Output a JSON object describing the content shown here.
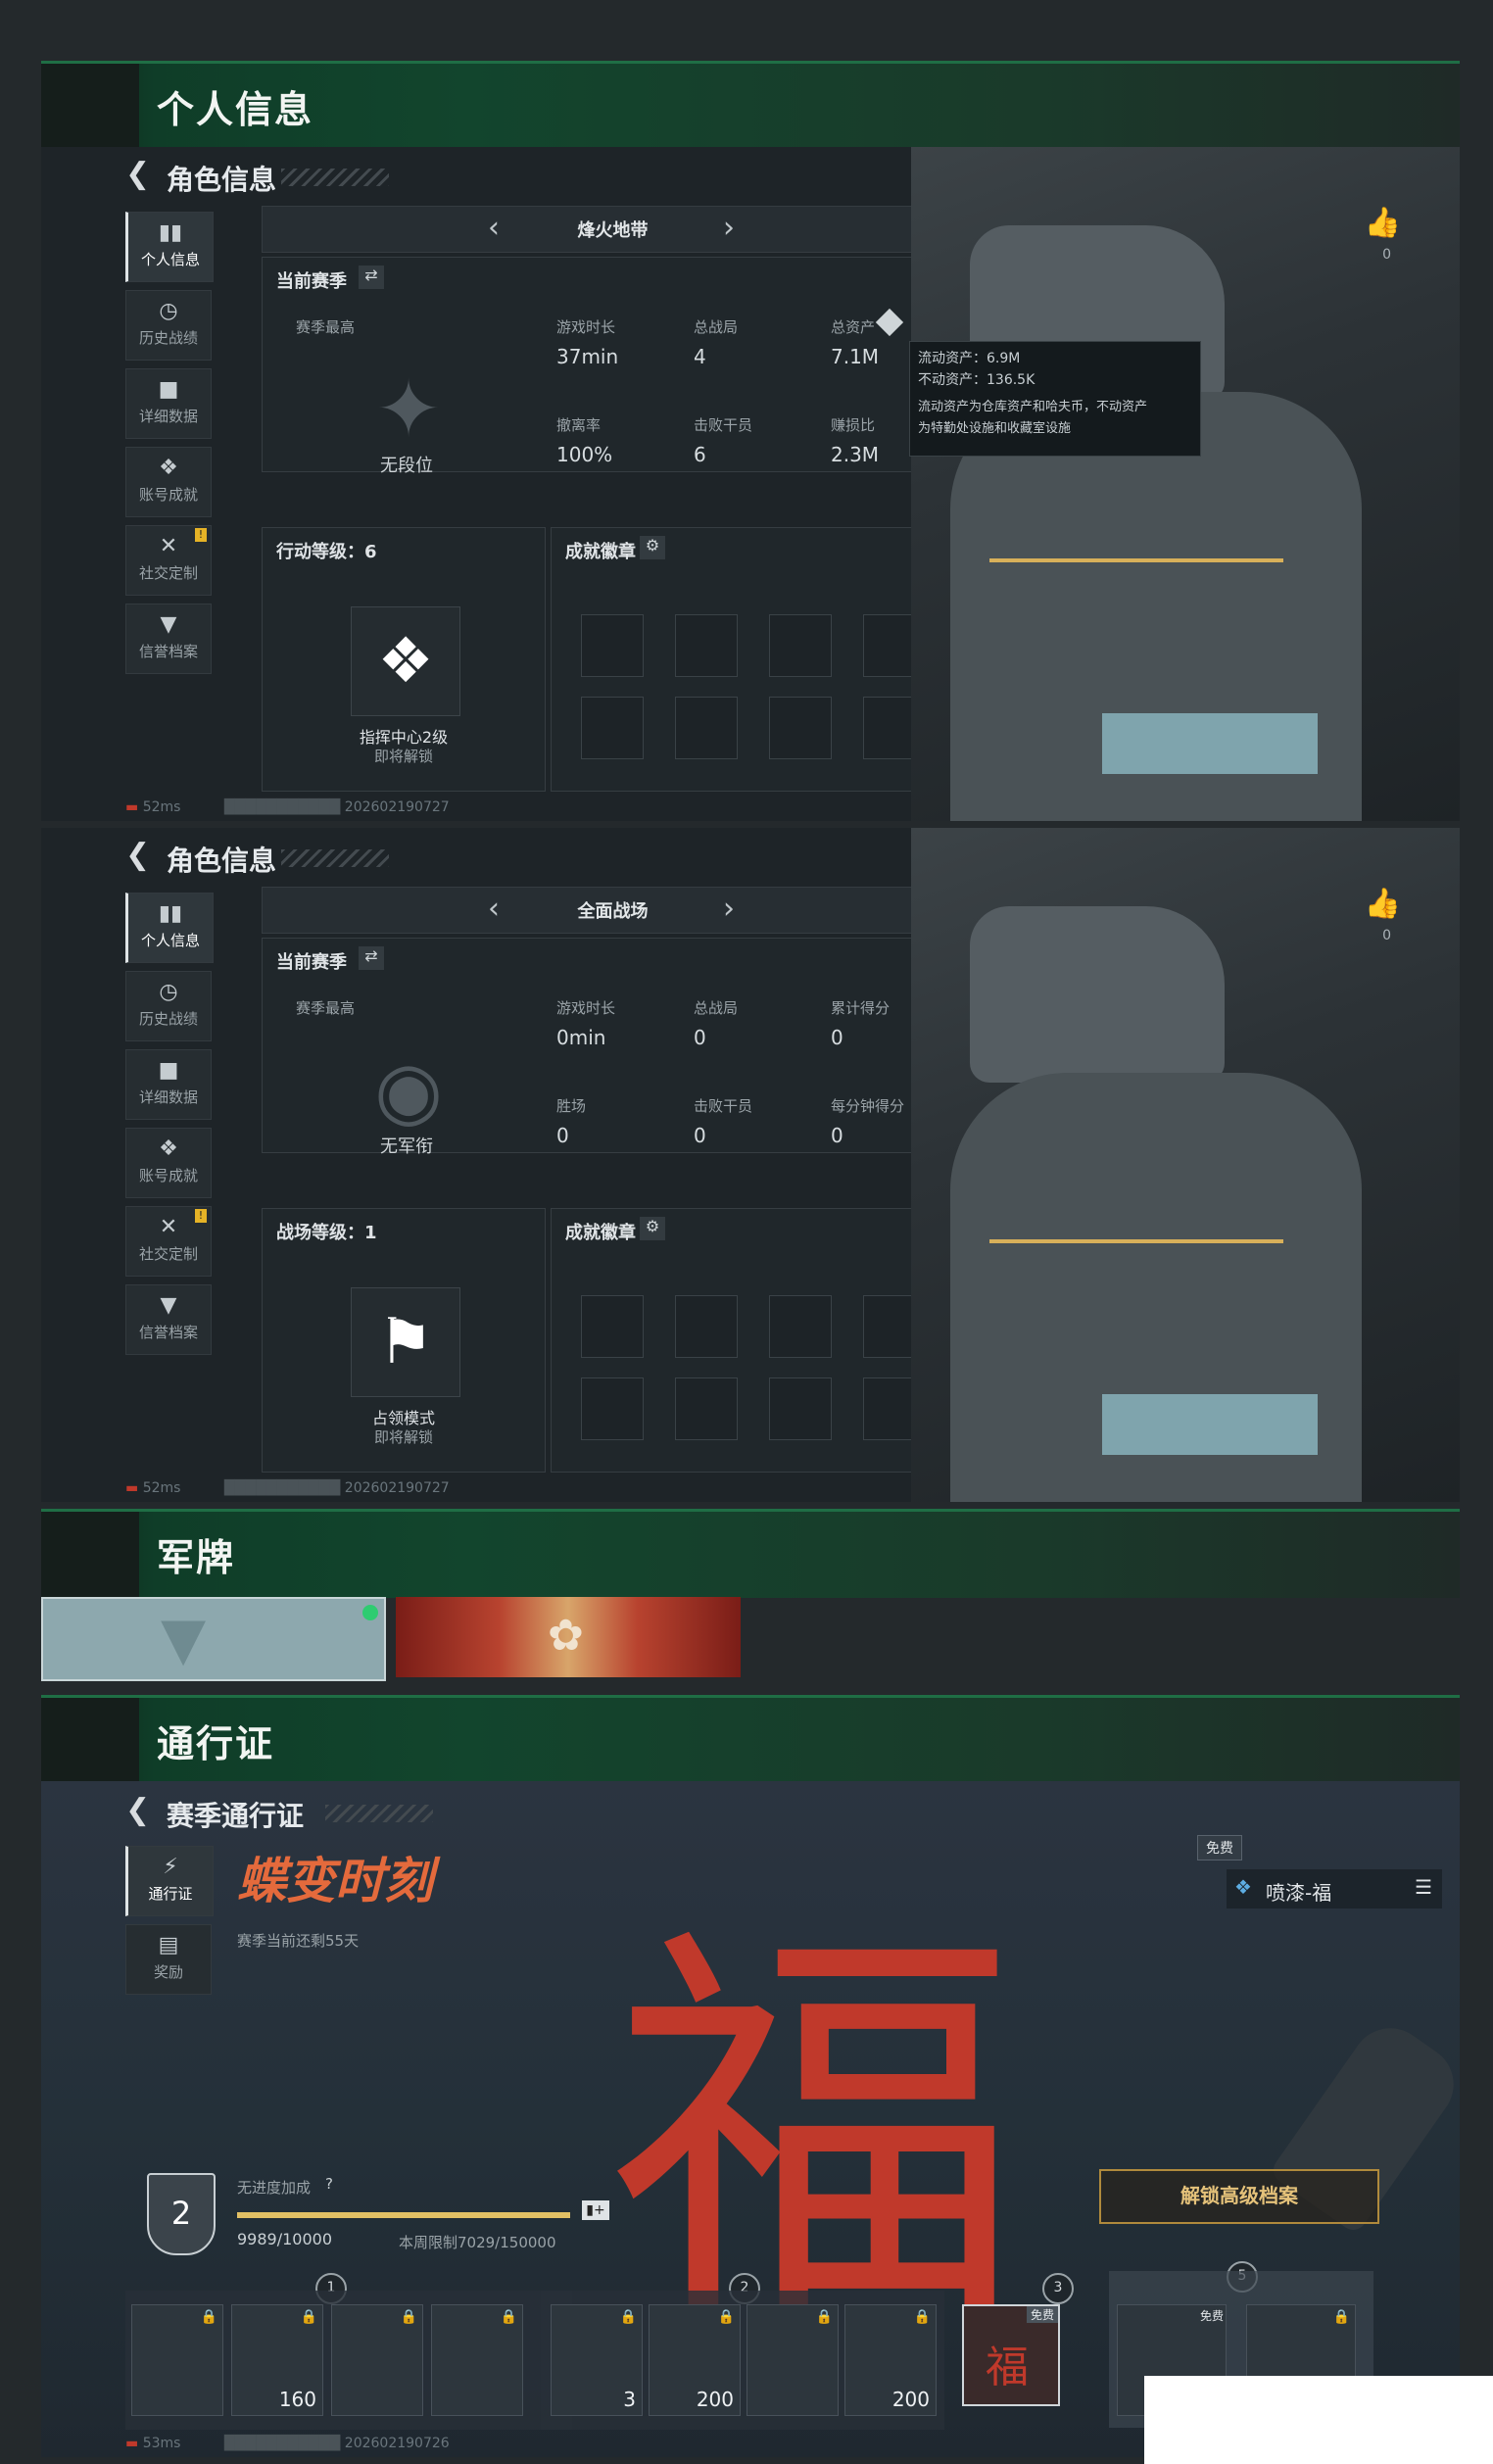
{
  "sections": {
    "personal_info": "个人信息",
    "military_tag": "军牌",
    "pass": "通行证"
  },
  "panel1": {
    "title": "角色信息",
    "mode": "烽火地带",
    "current_season": "当前赛季",
    "season_best": "赛季最高",
    "rank": "无段位",
    "stats": [
      {
        "label": "游戏时长",
        "value": "37min"
      },
      {
        "label": "总战局",
        "value": "4"
      },
      {
        "label": "总资产",
        "value": "7.1M"
      },
      {
        "label": "撤离率",
        "value": "100%"
      },
      {
        "label": "击败干员",
        "value": "6"
      },
      {
        "label": "赚损比",
        "value": "2.3M"
      }
    ],
    "tooltip": {
      "line1": "流动资产：6.9M",
      "line2": "不动资产：136.5K",
      "line3": "流动资产为仓库资产和哈夫币，不动资产",
      "line4": "为特勤处设施和收藏室设施"
    },
    "level_label": "行动等级：6",
    "level_item_name": "指挥中心2级",
    "level_item_sub": "即将解锁",
    "badges_label": "成就徽章",
    "like_count": "0",
    "ping": "52ms",
    "uid": "202602190727"
  },
  "panel2": {
    "title": "角色信息",
    "mode": "全面战场",
    "current_season": "当前赛季",
    "season_best": "赛季最高",
    "rank": "无军衔",
    "stats": [
      {
        "label": "游戏时长",
        "value": "0min"
      },
      {
        "label": "总战局",
        "value": "0"
      },
      {
        "label": "累计得分",
        "value": "0"
      },
      {
        "label": "胜场",
        "value": "0"
      },
      {
        "label": "击败干员",
        "value": "0"
      },
      {
        "label": "每分钟得分",
        "value": "0"
      }
    ],
    "level_label": "战场等级：1",
    "level_item_name": "占领模式",
    "level_item_sub": "即将解锁",
    "badges_label": "成就徽章",
    "like_count": "0",
    "ping": "52ms",
    "uid": "202602190727"
  },
  "sidebar": [
    {
      "label": "个人信息",
      "icon": "bar-chart-icon"
    },
    {
      "label": "历史战绩",
      "icon": "history-icon"
    },
    {
      "label": "详细数据",
      "icon": "folder-icon"
    },
    {
      "label": "账号成就",
      "icon": "medal-icon"
    },
    {
      "label": "社交定制",
      "icon": "tools-icon",
      "badge": "!"
    },
    {
      "label": "信誉档案",
      "icon": "shield-icon"
    }
  ],
  "pass": {
    "title": "赛季通行证",
    "side": [
      {
        "label": "通行证"
      },
      {
        "label": "奖励"
      }
    ],
    "season_name": "蝶变时刻",
    "remaining": "赛季当前还剩55天",
    "free_tag": "免费",
    "item_name": "喷漆-福",
    "level": "2",
    "bonus_label": "无进度加成",
    "progress": "9989/10000",
    "progress_fraction": 0.9989,
    "weekly": "本周限制7029/150000",
    "unlock_button": "解锁高级档案",
    "tiers": [
      "1",
      "2",
      "3",
      "5"
    ],
    "tier_items": [
      {
        "n": ""
      },
      {
        "n": "160"
      },
      {
        "n": ""
      },
      {
        "n": ""
      },
      {
        "n": "3"
      },
      {
        "n": "200"
      },
      {
        "n": ""
      },
      {
        "n": "200"
      },
      {
        "n": "",
        "free": "免费"
      },
      {
        "n": "",
        "free": "免费"
      },
      {
        "n": ""
      }
    ],
    "ping": "53ms",
    "uid": "202602190726"
  },
  "colors": {
    "accent_green": "#1f6e45",
    "gold": "#d8b05a",
    "pass_red": "#c0392b"
  }
}
